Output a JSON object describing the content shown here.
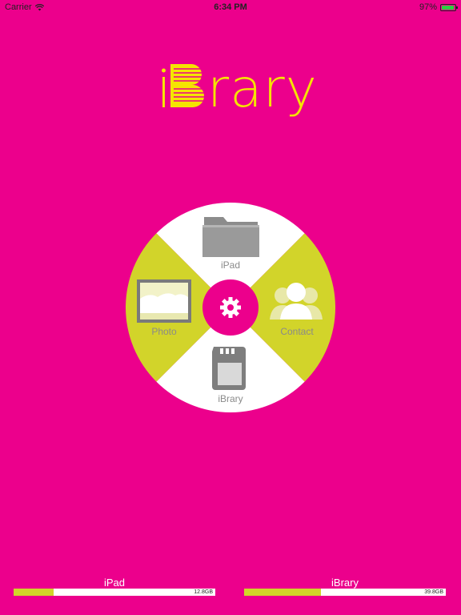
{
  "status_bar": {
    "carrier": "Carrier",
    "time": "6:34 PM",
    "battery_text": "97%",
    "battery_level": 0.97
  },
  "app": {
    "logo_text": "iBrary"
  },
  "wheel": {
    "top_label": "iPad",
    "left_label": "Photo",
    "right_label": "Contact",
    "bottom_label": "iBrary",
    "colors": {
      "accent": "#d2d42a",
      "background": "#ec008c",
      "segment_light": "#ffffff"
    }
  },
  "storage": [
    {
      "label": "iPad",
      "size": "12.8GB",
      "fill": 0.2
    },
    {
      "label": "iBrary",
      "size": "39.8GB",
      "fill": 0.38
    }
  ]
}
